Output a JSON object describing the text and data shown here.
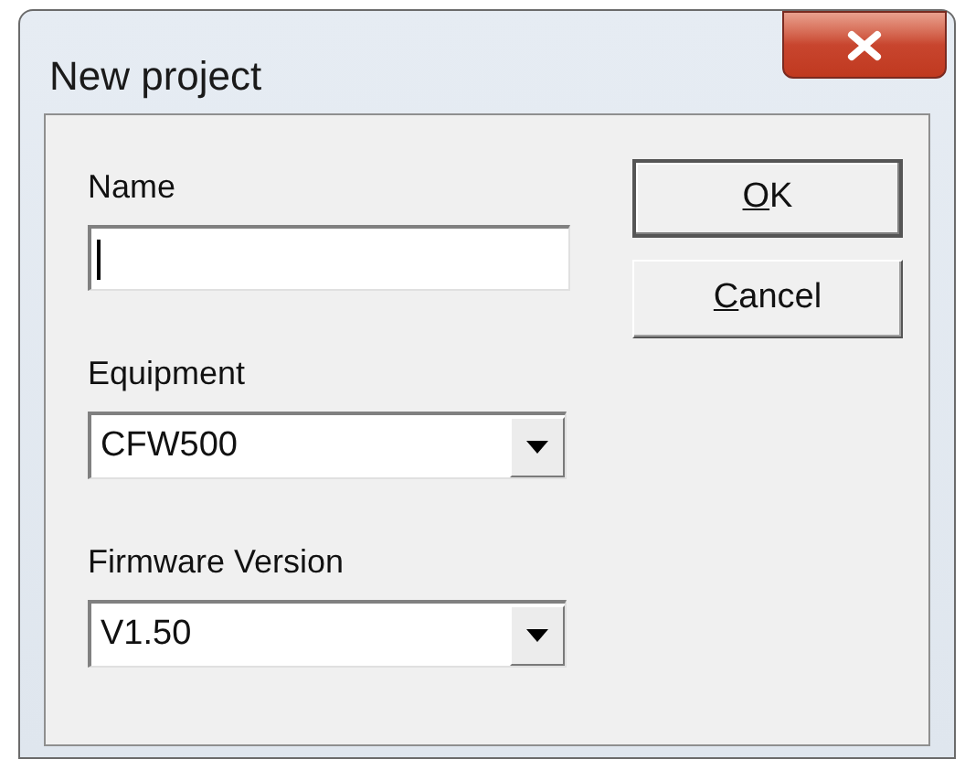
{
  "window": {
    "title": "New project"
  },
  "fields": [
    {
      "kind": "text",
      "label": "Name",
      "focused": true
    },
    {
      "kind": "combo",
      "label": "Equipment",
      "value": "CFW500"
    },
    {
      "kind": "combo",
      "label": "Firmware Version",
      "value": "V1.50"
    }
  ],
  "buttons": [
    {
      "label": "OK",
      "default": true
    },
    {
      "label": "Cancel",
      "default": false
    }
  ]
}
